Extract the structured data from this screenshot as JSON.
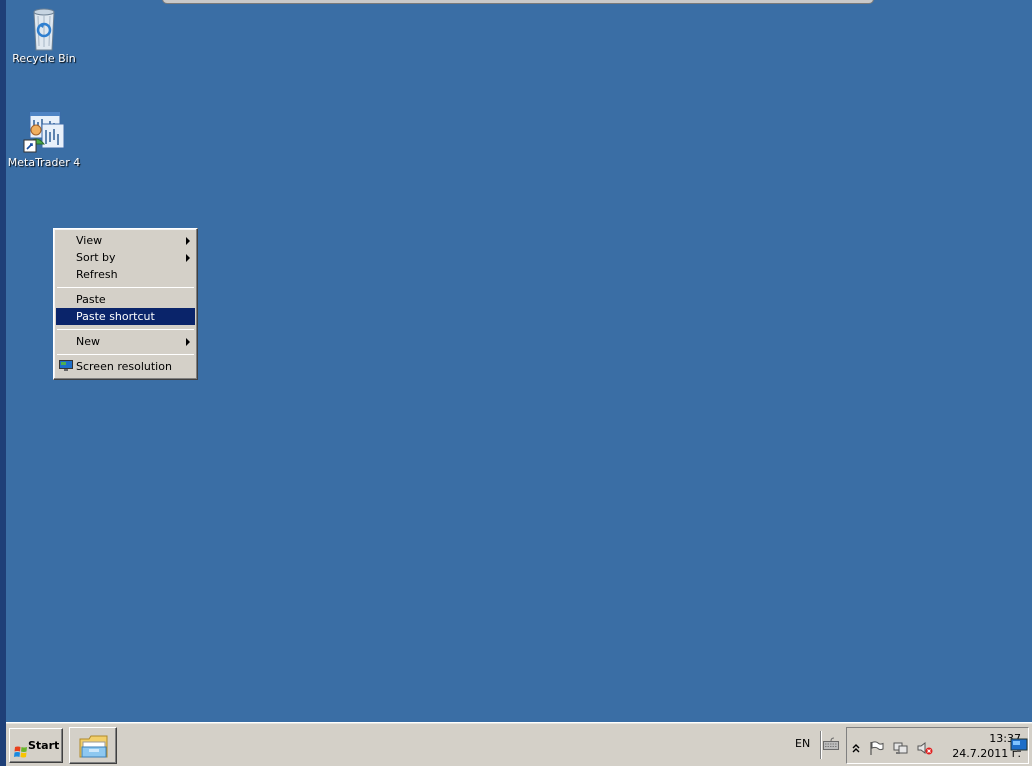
{
  "desktop": {
    "icons": [
      {
        "label": "Recycle Bin",
        "icon": "recycle-bin-icon"
      },
      {
        "label": "MetaTrader 4",
        "icon": "metatrader-icon"
      }
    ]
  },
  "context_menu": {
    "items": [
      {
        "label": "View",
        "submenu": true
      },
      {
        "label": "Sort by",
        "submenu": true
      },
      {
        "label": "Refresh",
        "submenu": false
      },
      {
        "label": "Paste",
        "submenu": false
      },
      {
        "label": "Paste shortcut",
        "submenu": false,
        "highlighted": true
      },
      {
        "label": "New",
        "submenu": true
      },
      {
        "label": "Screen resolution",
        "submenu": false,
        "icon": "monitor-icon"
      }
    ]
  },
  "taskbar": {
    "start_label": "Start",
    "language": "EN",
    "clock_time": "13:37",
    "clock_date": "24.7.2011 г."
  },
  "colors": {
    "desktop": "#3a6ea5",
    "menu_bg": "#d4d0c8",
    "highlight": "#0a246a"
  }
}
